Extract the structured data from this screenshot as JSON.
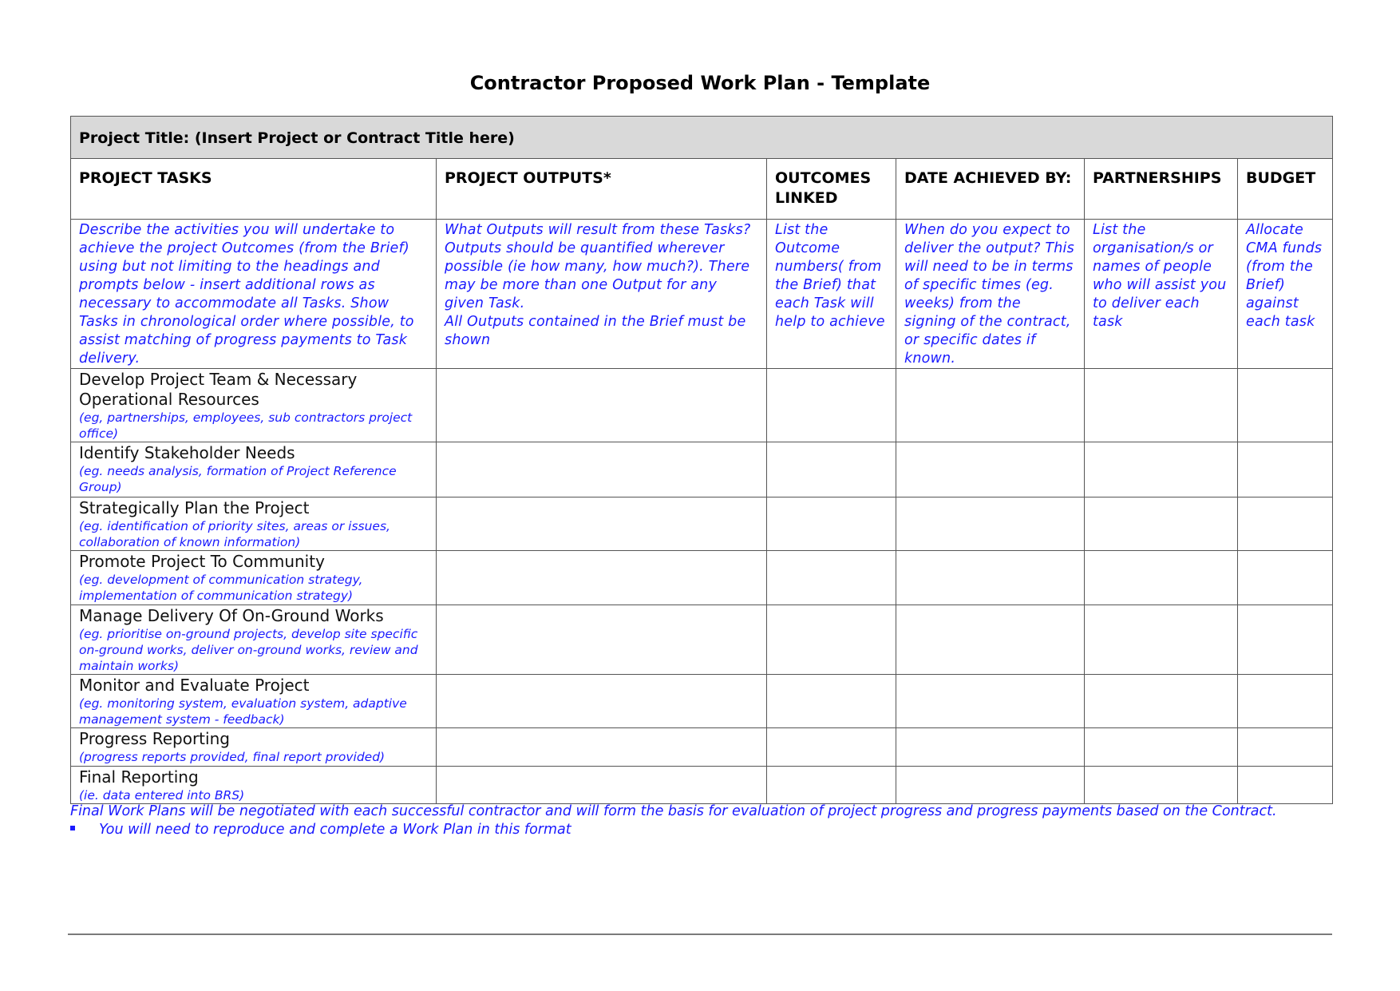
{
  "document": {
    "title": "Contractor Proposed Work Plan - Template",
    "project_title_row": "Project Title:   (Insert Project or Contract Title here)"
  },
  "columns": [
    {
      "header": "PROJECT TASKS",
      "instruction": "Describe the activities you will undertake to achieve the project Outcomes (from the Brief) using but not limiting to the headings and prompts below - insert additional rows as necessary to accommodate all Tasks. Show Tasks in chronological order where possible, to assist matching of progress payments to Task delivery."
    },
    {
      "header": "PROJECT OUTPUTS*",
      "instruction": "What Outputs will result from these Tasks? Outputs should be quantified wherever possible (ie how many, how much?). There may be more than one Output for any given Task.",
      "instruction_2": "All Outputs contained in the Brief must be shown"
    },
    {
      "header": "OUTCOMES LINKED",
      "instruction": "List the Outcome numbers( from the Brief) that each Task will help to achieve"
    },
    {
      "header": "DATE ACHIEVED BY:",
      "instruction": "When do you expect to deliver the output? This will need to be in terms of specific times (eg. weeks) from the signing of the contract, or specific dates if known."
    },
    {
      "header": "PARTNERSHIPS",
      "instruction": "List the organisation/s or names of people who will assist you to deliver each task"
    },
    {
      "header": "BUDGET",
      "instruction": "Allocate CMA funds (from the Brief) against each task"
    }
  ],
  "tasks": [
    {
      "name": "Develop Project Team & Necessary Operational Resources",
      "hint": "(eg, partnerships, employees, sub contractors project office)"
    },
    {
      "name": "Identify Stakeholder Needs",
      "hint": "(eg. needs analysis, formation of Project Reference Group)"
    },
    {
      "name": "Strategically Plan the Project",
      "hint": "(eg. identification of priority sites, areas or issues, collaboration of known information)"
    },
    {
      "name": "Promote Project To Community",
      "hint": "(eg. development of communication strategy, implementation of communication strategy)"
    },
    {
      "name": "Manage Delivery Of On-Ground Works",
      "hint": "(eg. prioritise on-ground projects, develop site specific  on-ground works, deliver on-ground works, review and maintain works)"
    },
    {
      "name": "Monitor and Evaluate Project",
      "hint": "(eg. monitoring system, evaluation system, adaptive management system - feedback)"
    },
    {
      "name": "Progress Reporting",
      "hint": "(progress reports provided, final report provided)"
    },
    {
      "name": "Final Reporting",
      "hint": "(ie. data entered into BRS)"
    }
  ],
  "footer": {
    "note": "Final Work Plans will be negotiated with each successful contractor and will form the basis for evaluation of project progress and progress payments based on the Contract.",
    "bullet": "You will need to reproduce and complete a Work Plan in this format"
  },
  "colors": {
    "instruction_text": "#1a1aff",
    "title_band": "#d9d9d9",
    "border": "#555555"
  }
}
